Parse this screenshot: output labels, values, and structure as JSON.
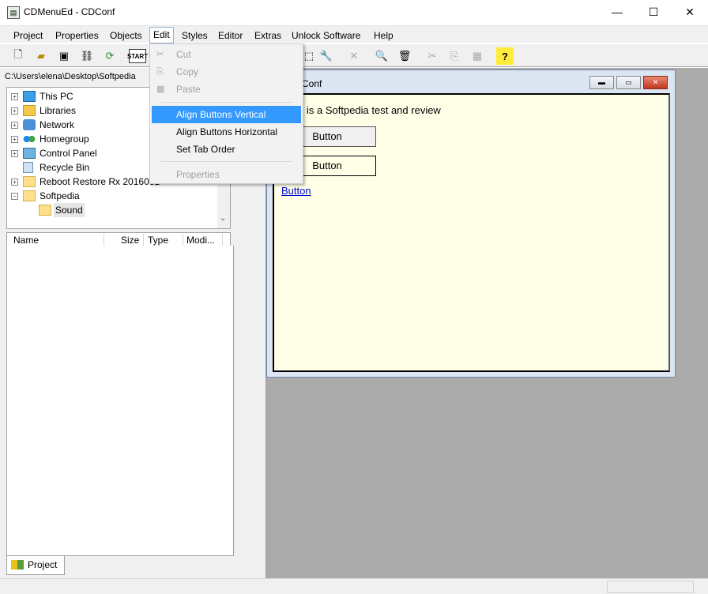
{
  "window": {
    "title": "CDMenuEd - CDConf",
    "min": "—",
    "max": "☐",
    "close": "✕"
  },
  "menu": [
    "Project",
    "Properties",
    "Objects",
    "Edit",
    "Styles",
    "Editor",
    "Extras",
    "Unlock Software",
    "Help"
  ],
  "path": "C:\\Users\\elena\\Desktop\\Softpedia",
  "tree": [
    {
      "label": "This PC",
      "exp": "+",
      "icon": "pc-icon"
    },
    {
      "label": "Libraries",
      "exp": "+",
      "icon": "library-icon"
    },
    {
      "label": "Network",
      "exp": "+",
      "icon": "network-icon"
    },
    {
      "label": "Homegroup",
      "exp": "+",
      "icon": "homegroup-icon"
    },
    {
      "label": "Control Panel",
      "exp": "+",
      "icon": "control-panel-icon"
    },
    {
      "label": "Recycle Bin",
      "exp": "",
      "icon": "recycle-bin-icon"
    },
    {
      "label": "Reboot Restore Rx 2016081",
      "exp": "+",
      "icon": "folder-icon"
    },
    {
      "label": "Softpedia",
      "exp": "−",
      "icon": "folder-icon"
    },
    {
      "label": "Sound",
      "exp": "",
      "icon": "folder-icon"
    }
  ],
  "list_columns": [
    "Name",
    "Size",
    "Type",
    "Modi..."
  ],
  "bottom_tab": "Project",
  "child": {
    "title": "Conf",
    "text": "is a Softpedia test and review",
    "button1": "Button",
    "button2": "Button",
    "link": "Button"
  },
  "edit_menu": {
    "cut": "Cut",
    "copy": "Copy",
    "paste": "Paste",
    "align_vertical": "Align Buttons Vertical",
    "align_horizontal": "Align Buttons Horizontal",
    "tab_order": "Set Tab Order",
    "properties": "Properties"
  },
  "colors": {
    "highlight": "#3399ff",
    "client_bg": "#ffffe8",
    "workspace": "#ababab"
  }
}
